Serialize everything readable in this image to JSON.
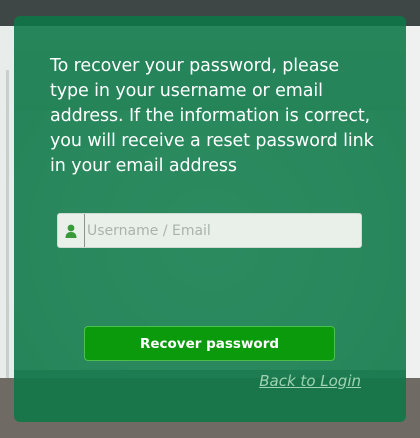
{
  "panel": {
    "message": "To recover your password, please type in your username or email address. If the information is correct, you will receive a reset password link in your email address",
    "username_input": {
      "placeholder": "Username / Email",
      "value": ""
    },
    "recover_button_label": "Recover password",
    "back_link_label": "Back to Login"
  },
  "colors": {
    "panel_bg": "#0a7846",
    "button_bg": "#0b9a0b",
    "link": "#9fd3b6",
    "icon": "#3a9a3a"
  },
  "icons": {
    "input_icon": "user-icon"
  }
}
